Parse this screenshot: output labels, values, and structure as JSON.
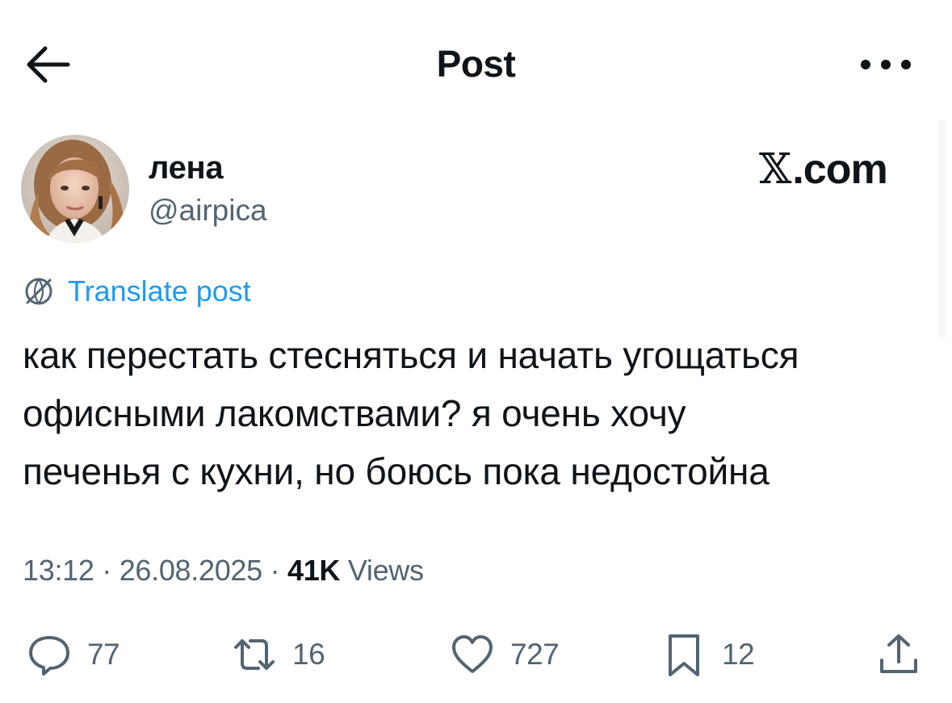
{
  "header": {
    "title": "Post",
    "back_icon": "arrow-left-icon",
    "more_icon": "ellipsis-icon"
  },
  "author": {
    "name": "лена",
    "handle": "@airpica",
    "avatar_icon": "user-avatar"
  },
  "watermark": {
    "x_glyph": "𝕏",
    "domain": ".com"
  },
  "translate": {
    "icon": "globe-icon",
    "label": "Translate post"
  },
  "post": {
    "text": "как перестать стесняться и начать угощаться\nофисными лакомствами? я очень хочу\nпеченья с кухни, но боюсь пока недостойна"
  },
  "meta": {
    "time": "13:12",
    "sep1": " · ",
    "date": "26.08.2025",
    "sep2": " · ",
    "views_count": "41K",
    "views_label": " Views"
  },
  "actions": {
    "reply": {
      "icon": "reply-icon",
      "count": "77"
    },
    "retweet": {
      "icon": "retweet-icon",
      "count": "16"
    },
    "like": {
      "icon": "heart-icon",
      "count": "727"
    },
    "bookmark": {
      "icon": "bookmark-icon",
      "count": "12"
    },
    "share": {
      "icon": "share-icon"
    }
  },
  "colors": {
    "text": "#0f1419",
    "secondary": "#536471",
    "accent": "#1d9bf0"
  }
}
